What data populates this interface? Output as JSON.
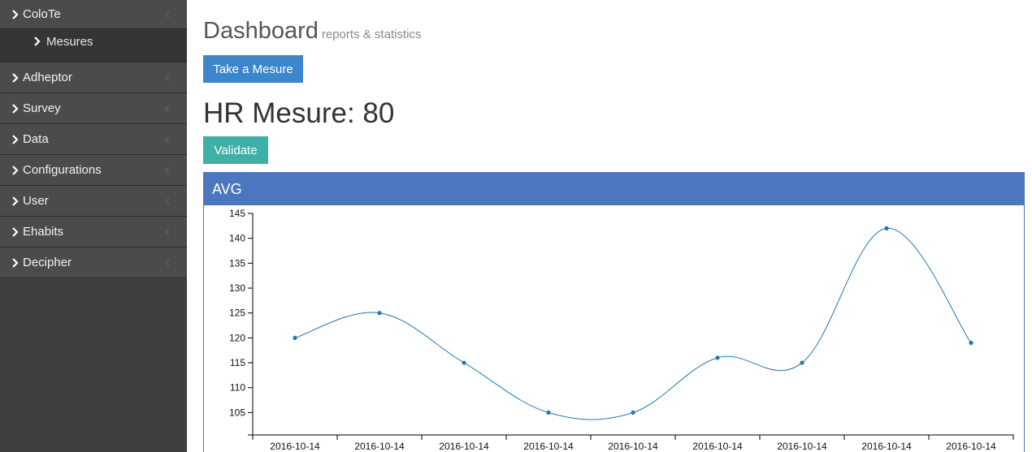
{
  "sidebar": {
    "items": [
      {
        "label": "ColoTe"
      },
      {
        "label": "Adheptor"
      },
      {
        "label": "Survey"
      },
      {
        "label": "Data"
      },
      {
        "label": "Configurations"
      },
      {
        "label": "User"
      },
      {
        "label": "Ehabits"
      },
      {
        "label": "Decipher"
      }
    ],
    "sub_items": [
      {
        "label": "Mesures"
      }
    ]
  },
  "header": {
    "title": "Dashboard",
    "subtitle": "reports & statistics"
  },
  "actions": {
    "take_measure_label": "Take a Mesure",
    "validate_label": "Validate"
  },
  "measure": {
    "title": "HR Mesure: 80"
  },
  "panel": {
    "title": "AVG"
  },
  "colors": {
    "sidebar_bg": "#3f3f3f",
    "primary": "#3c86cc",
    "success": "#3fb0a8",
    "panel_header": "#4a77bd",
    "line": "#1f77b4"
  },
  "icons": {
    "nav_chevron": "chevron-right-icon",
    "collapse_caret": "chevron-left-icon"
  },
  "chart_data": {
    "type": "line",
    "categories": [
      "2016-10-14",
      "2016-10-14",
      "2016-10-14",
      "2016-10-14",
      "2016-10-14",
      "2016-10-14",
      "2016-10-14",
      "2016-10-14",
      "2016-10-14"
    ],
    "values": [
      120,
      125,
      115,
      105,
      105,
      116,
      115,
      142,
      119
    ],
    "ylim": [
      100.5,
      145
    ],
    "yticks": [
      105,
      110,
      115,
      120,
      125,
      130,
      135,
      140,
      145
    ],
    "curve": "smooth",
    "grid": false,
    "title": "",
    "xlabel": "",
    "ylabel": ""
  }
}
